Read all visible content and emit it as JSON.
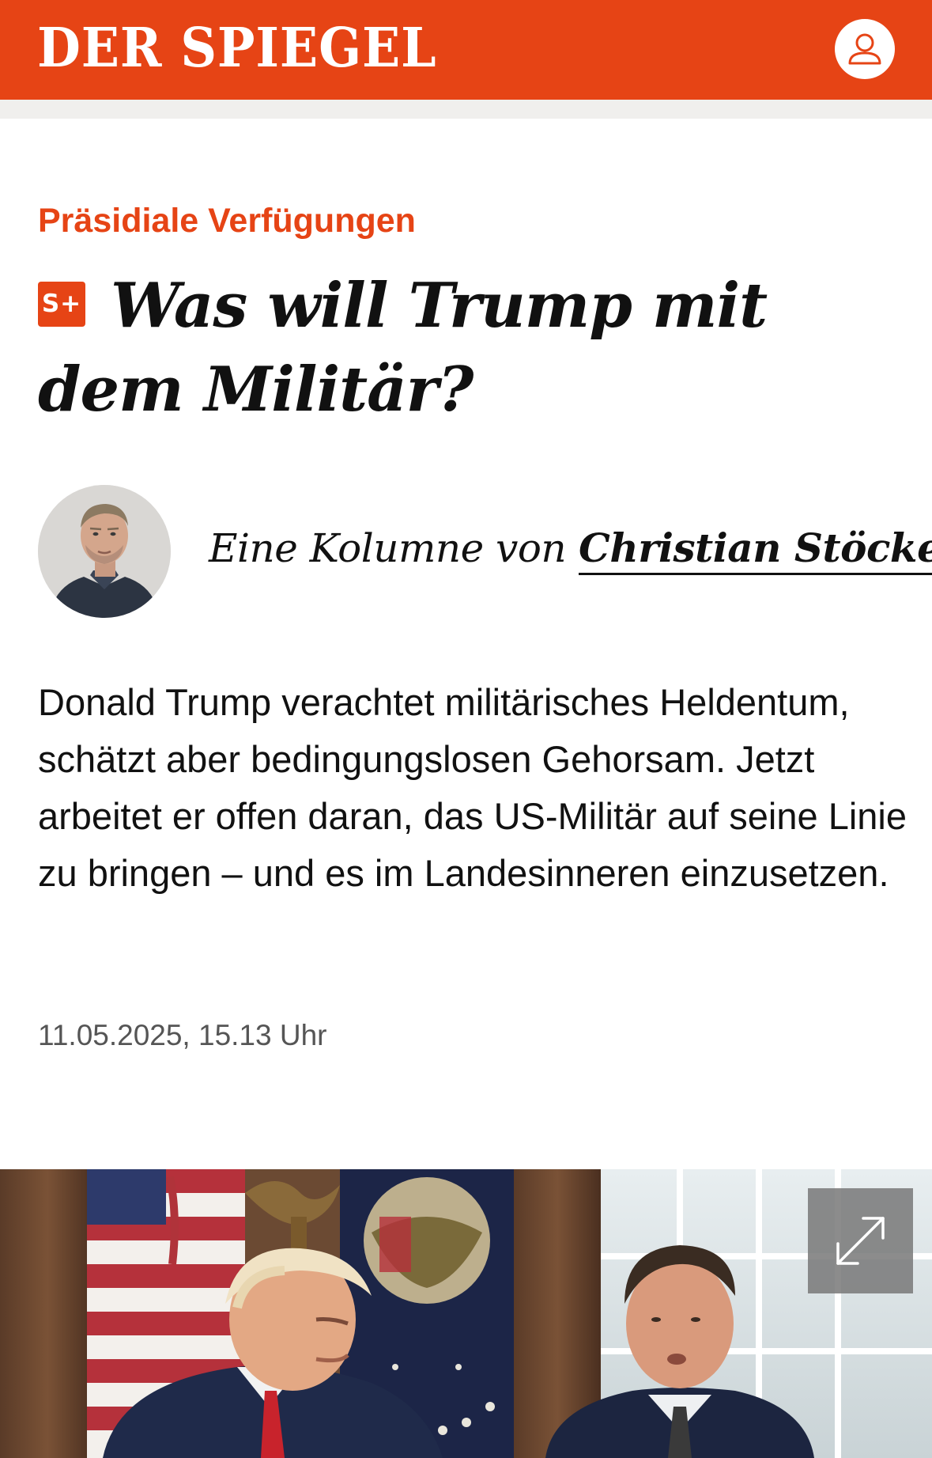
{
  "header": {
    "logo_text": "DER SPIEGEL",
    "brand_color": "#e64415",
    "account_icon": "user-icon"
  },
  "article": {
    "kicker": "Präsidiale Verfügungen",
    "badge": "S+",
    "headline": "Was will Trump mit dem Militär?",
    "byline_lead": "Eine Kolumne von",
    "author_name": "Christian Stöcker",
    "teaser": "Donald Trump verachtet militärisches Heldentum, schätzt aber bedingungslosen Gehorsam. Jetzt arbeitet er offen daran, das US-Militär auf seine Linie zu bringen – und es im Landesinneren einzusetzen.",
    "timestamp": "11.05.2025, 15.13 Uhr"
  },
  "hero_image": {
    "expand_icon": "expand-icon"
  }
}
